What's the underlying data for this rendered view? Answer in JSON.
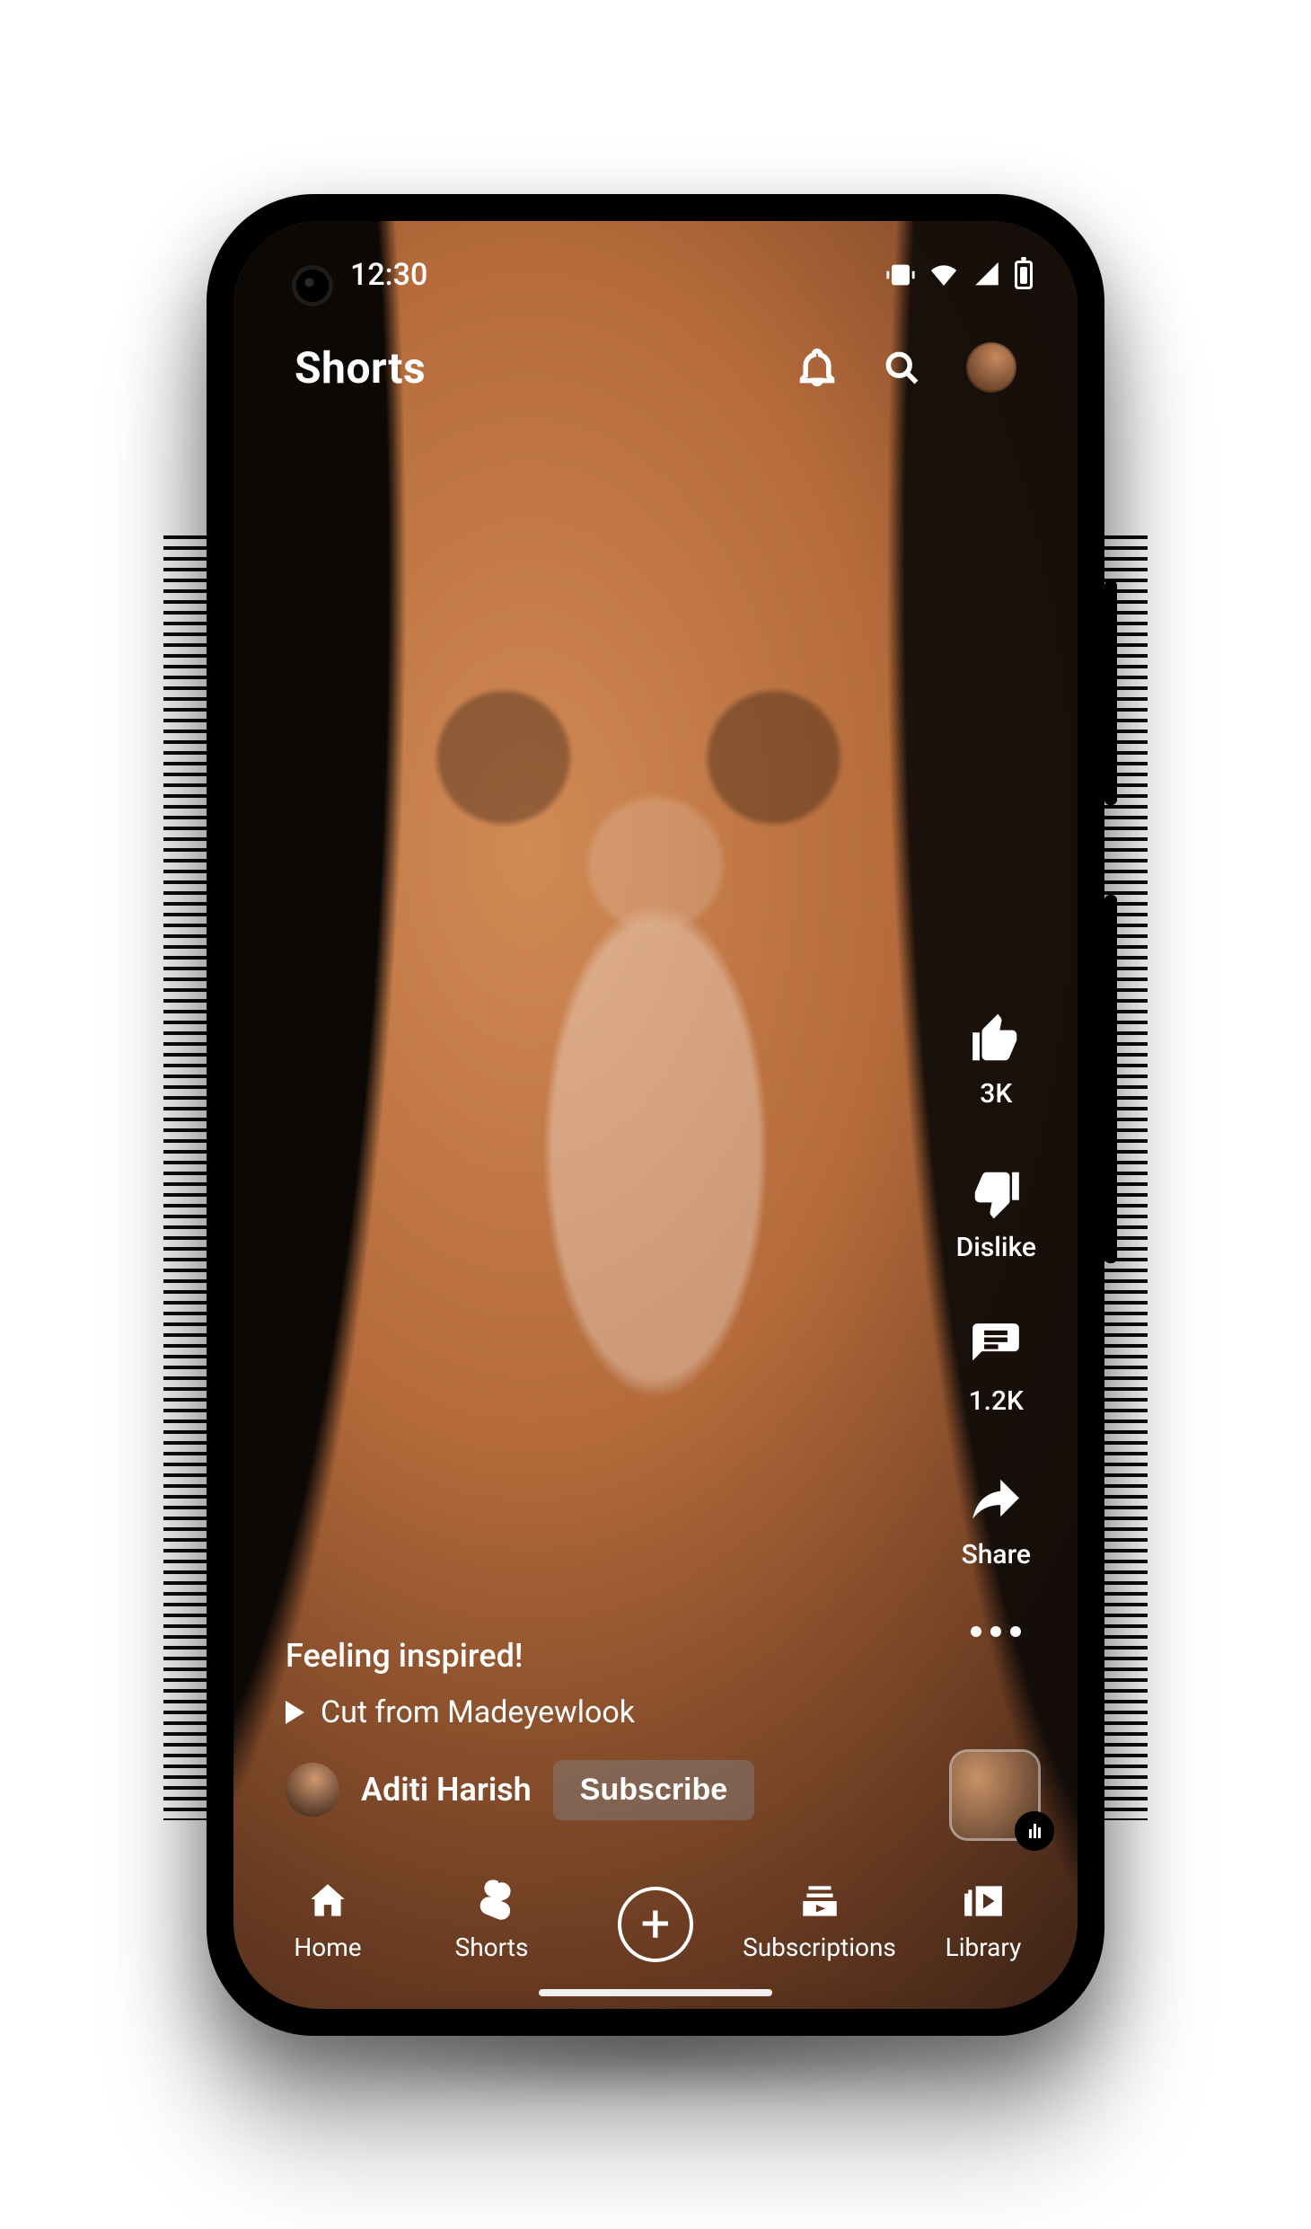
{
  "status": {
    "time": "12:30"
  },
  "appbar": {
    "title": "Shorts",
    "icons": {
      "bell": "bell-icon",
      "search": "search-icon",
      "avatar": "account-avatar"
    }
  },
  "actions": {
    "like_count": "3K",
    "dislike_label": "Dislike",
    "comments_count": "1.2K",
    "share_label": "Share"
  },
  "meta": {
    "caption": "Feeling inspired!",
    "cut_label": "Cut from Madeyewlook"
  },
  "creator": {
    "name": "Aditi Harish",
    "subscribe_label": "Subscribe"
  },
  "bottomnav": {
    "home": "Home",
    "shorts": "Shorts",
    "subs": "Subscriptions",
    "library": "Library"
  }
}
